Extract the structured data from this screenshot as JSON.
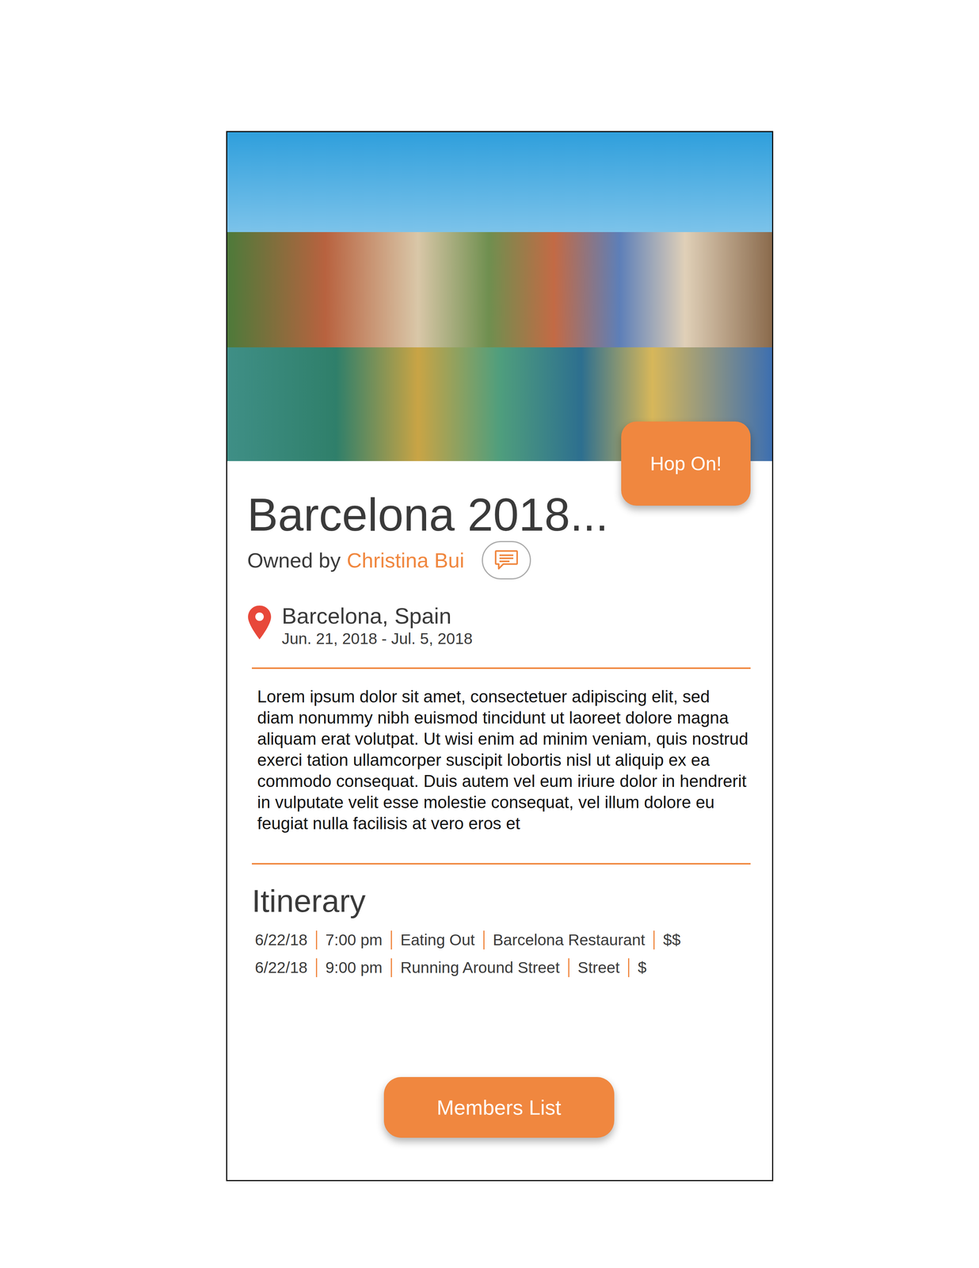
{
  "trip": {
    "title": "Barcelona 2018...",
    "owner_label": "Owned by",
    "owner": "Christina Bui",
    "location": "Barcelona, Spain",
    "dates": "Jun. 21, 2018 - Jul. 5, 2018",
    "description": "Lorem ipsum dolor sit amet, consectetuer adipiscing elit, sed diam nonummy nibh euismod tincidunt ut laoreet dolore magna aliquam erat volutpat. Ut wisi enim ad minim veniam, quis nostrud exerci tation ullamcorper suscipit lobortis nisl ut aliquip ex ea commodo consequat. Duis autem vel eum iriure dolor in hendrerit in vulputate velit esse molestie consequat, vel illum dolore eu feugiat nulla facilisis at vero eros et"
  },
  "buttons": {
    "hop_on": "Hop On!",
    "members": "Members List"
  },
  "itinerary": {
    "title": "Itinerary",
    "rows": [
      {
        "date": "6/22/18",
        "time": "7:00 pm",
        "activity": "Eating Out",
        "place": "Barcelona Restaurant",
        "price": "$$"
      },
      {
        "date": "6/22/18",
        "time": "9:00 pm",
        "activity": "Running Around Street",
        "place": "Street",
        "price": "$"
      }
    ]
  }
}
